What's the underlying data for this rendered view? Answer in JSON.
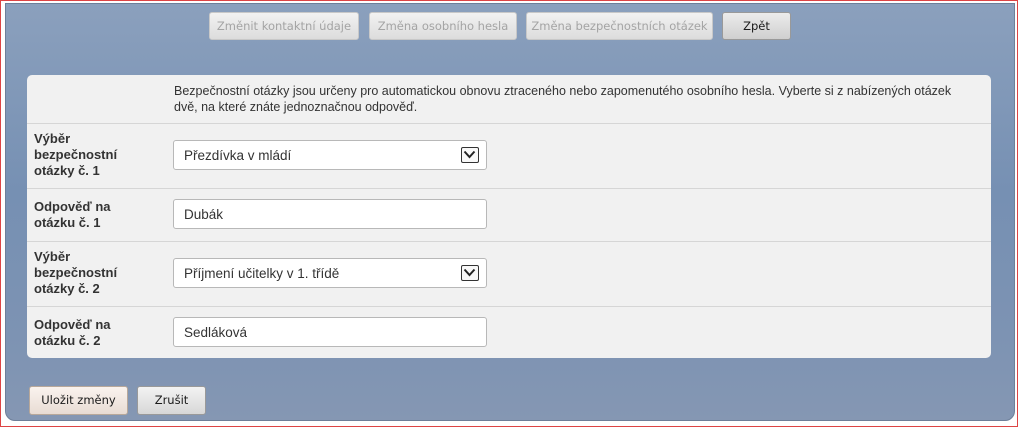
{
  "tabs": [
    {
      "label": "Změnit kontaktní údaje",
      "enabled": false
    },
    {
      "label": "Změna osobního hesla",
      "enabled": false
    },
    {
      "label": "Změna bezpečnostních otázek",
      "enabled": false
    },
    {
      "label": "Zpět",
      "enabled": true
    }
  ],
  "intro": "Bezpečnostní otázky jsou určeny pro automatickou obnovu ztraceného nebo zapomenutého osobního hesla. Vyberte si z nabízených otázek dvě, na které znáte jednoznačnou odpověď.",
  "form": {
    "q1_label": "Výběr bezpečnostní otázky č. 1",
    "q1_value": "Přezdívka v mládí",
    "a1_label": "Odpověď na otázku č. 1",
    "a1_value": "Dubák",
    "q2_label": "Výběr bezpečnostní otázky č. 2",
    "q2_value": "Příjmení učitelky v 1. třídě",
    "a2_label": "Odpověď na otázku č. 2",
    "a2_value": "Sedláková"
  },
  "actions": {
    "save_label": "Uložit změny",
    "cancel_label": "Zrušit"
  },
  "icons": {
    "select_arrow": "chevron-down-icon"
  },
  "colors": {
    "panel_background": "#7690b3",
    "card_background": "#f1f1f1",
    "frame_border": "#dd4444"
  }
}
